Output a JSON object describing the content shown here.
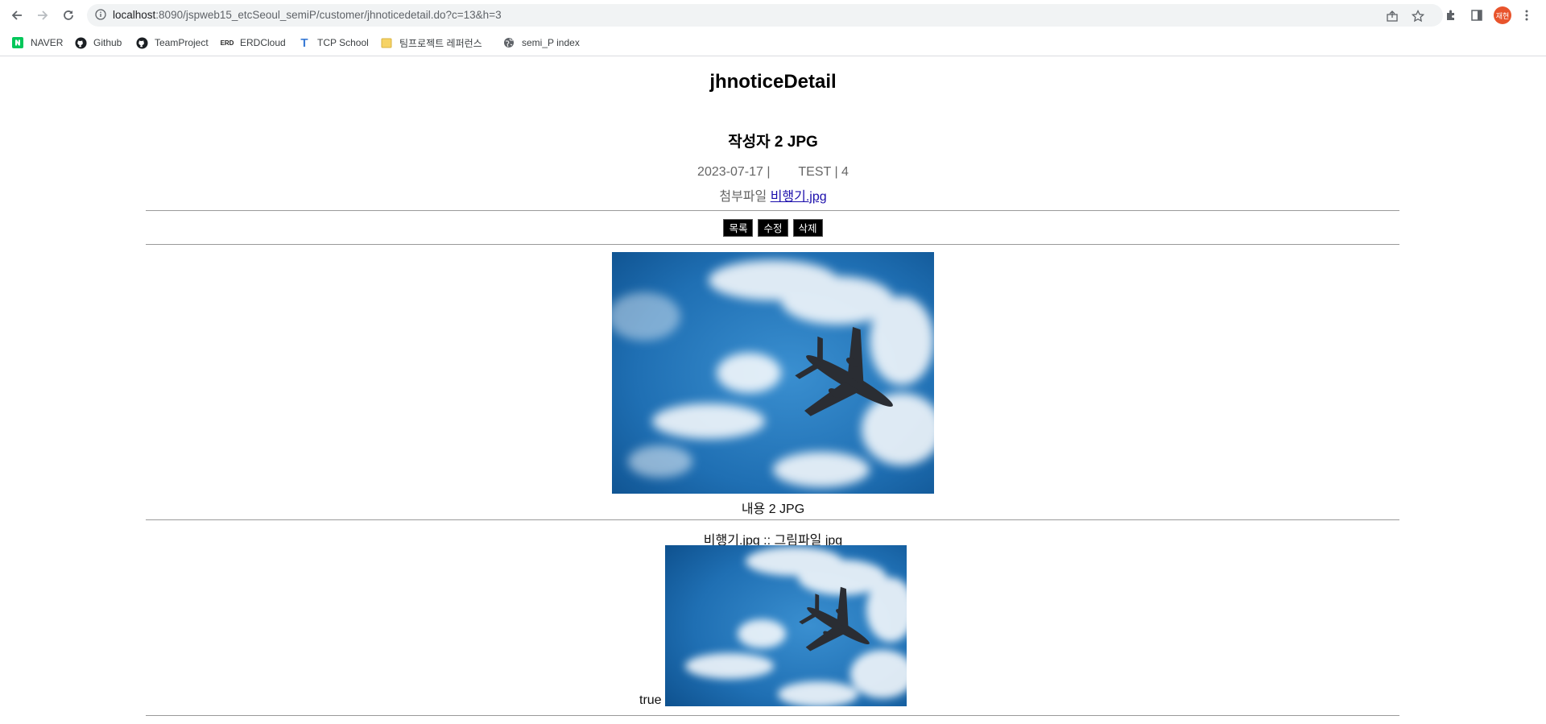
{
  "browser": {
    "url_host": "localhost",
    "url_rest": ":8090/jspweb15_etcSeoul_semiP/customer/jhnoticedetail.do?c=13&h=3",
    "profile_initials": "재현"
  },
  "bookmarks": [
    {
      "label": "NAVER",
      "icon": "naver-icon"
    },
    {
      "label": "Github",
      "icon": "github-icon"
    },
    {
      "label": "TeamProject",
      "icon": "github-icon"
    },
    {
      "label": "ERDCloud",
      "icon": "erd-icon"
    },
    {
      "label": "TCP School",
      "icon": "tcp-icon"
    },
    {
      "label": "팀프로젝트 레퍼런스",
      "icon": "folder-icon"
    },
    {
      "label": "semi_P index",
      "icon": "globe-icon"
    }
  ],
  "page": {
    "heading": "jhnoticeDetail",
    "post_title": "작성자 2 JPG",
    "date": "2023-07-17 |",
    "writer_hits": "TEST | 4",
    "attachment_label": "첨부파일",
    "attachment_file": "비행기.jpg",
    "buttons": {
      "list": "목록",
      "edit": "수정",
      "delete": "삭제"
    },
    "body_text": "내용 2 JPG",
    "file_caption": "비행기.jpg :: 그림파일 jpg",
    "bool_text": "true"
  },
  "colors": {
    "sky_dark": "#0d4f8c",
    "sky_light": "#3a8fd0",
    "button_bg": "#000000",
    "link": "#1a0dab"
  }
}
